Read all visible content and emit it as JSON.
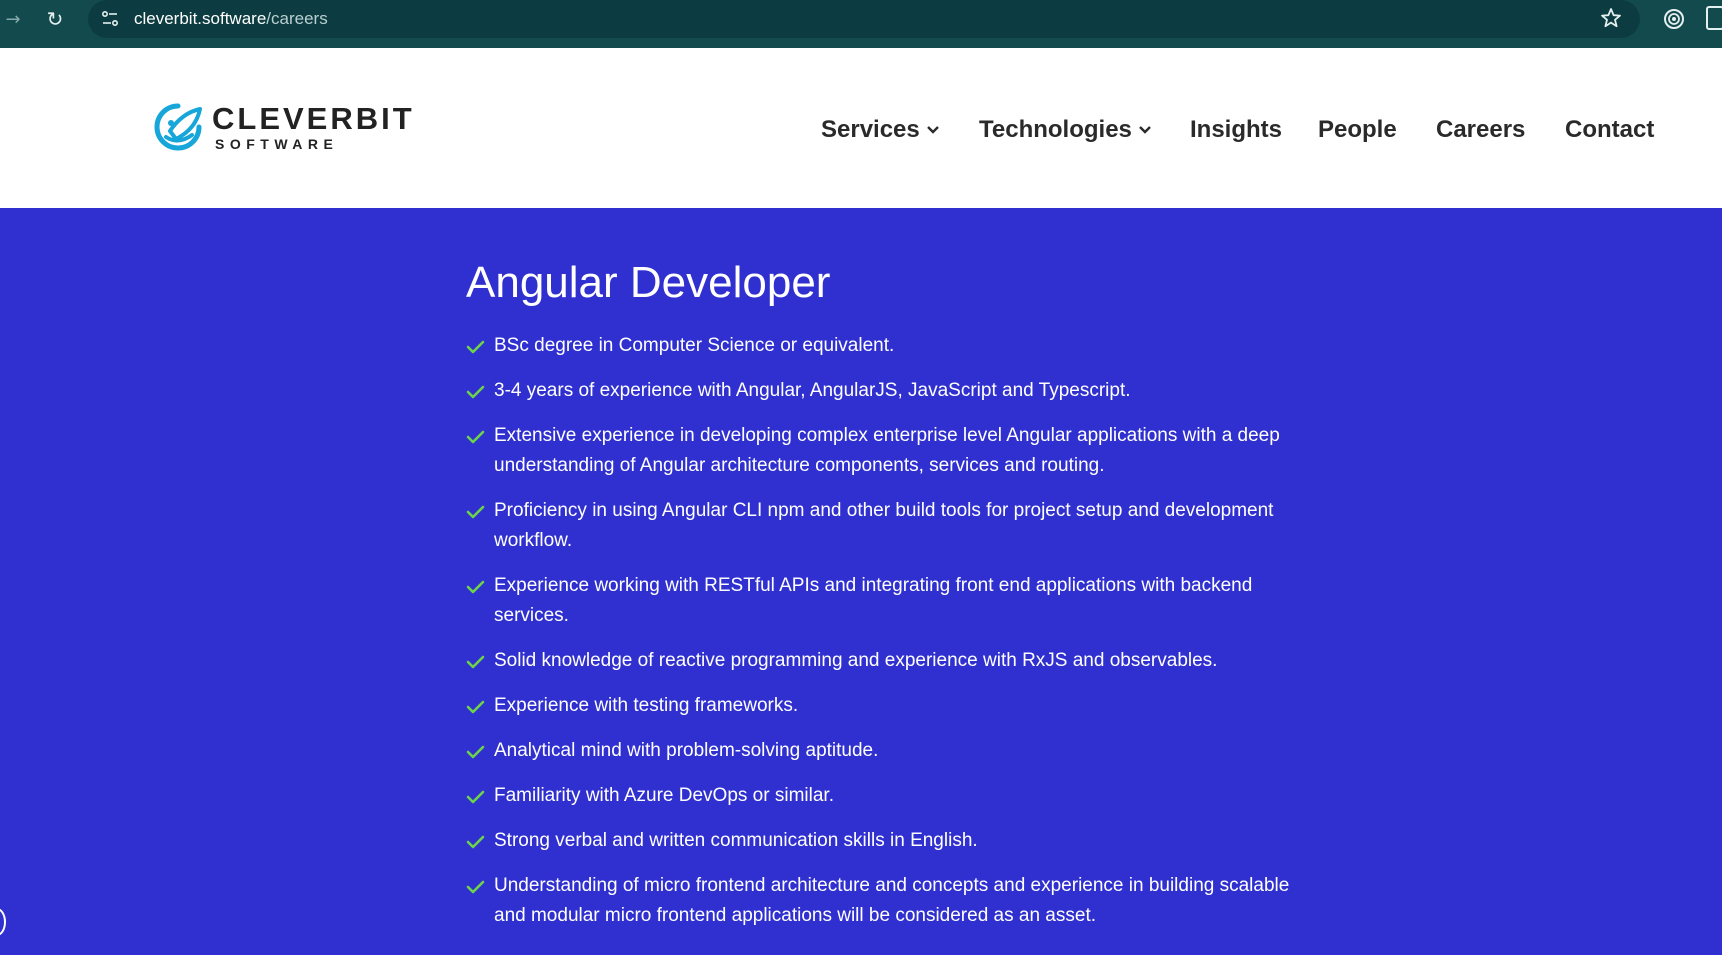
{
  "browser": {
    "url_domain": "cleverbit.software",
    "url_path": "/careers",
    "icons": [
      "forward-icon",
      "reload-icon",
      "site-info-icon",
      "bookmark-star-icon",
      "extension-icon",
      "extensions-puzzle-icon"
    ]
  },
  "header": {
    "logo_word": "CLEVERBIT",
    "logo_sub": "SOFTWARE",
    "nav": [
      {
        "label": "Services"
      },
      {
        "label": "Technologies"
      },
      {
        "label": "Insights"
      },
      {
        "label": "People"
      },
      {
        "label": "Careers"
      },
      {
        "label": "Contact"
      }
    ]
  },
  "main": {
    "title": "Angular Developer",
    "requirements": [
      "BSc degree in Computer Science or equivalent.",
      "3-4 years of experience with Angular, AngularJS, JavaScript and Typescript.",
      "Extensive experience in developing complex enterprise level Angular applications with a deep understanding of Angular architecture components, services and routing.",
      "Proficiency in using Angular CLI npm and other build tools for project setup and development workflow.",
      "Experience working with RESTful APIs and integrating front end applications with backend services.",
      "Solid knowledge of reactive programming and experience with RxJS and observables.",
      "Experience with testing frameworks.",
      "Analytical mind with problem-solving aptitude.",
      "Familiarity with Azure DevOps or similar.",
      "Strong verbal and written communication skills in English.",
      "Understanding of micro frontend architecture and concepts and experience in building scalable and modular micro frontend applications will be considered as an asset."
    ]
  },
  "colors": {
    "browser_bar": "#124a4e",
    "url_pill": "#0c3c41",
    "page_background": "#3030d0",
    "logo_accent": "#16a6d9",
    "check_color": "#6cd34a",
    "nav_text": "#2a2a2a"
  }
}
